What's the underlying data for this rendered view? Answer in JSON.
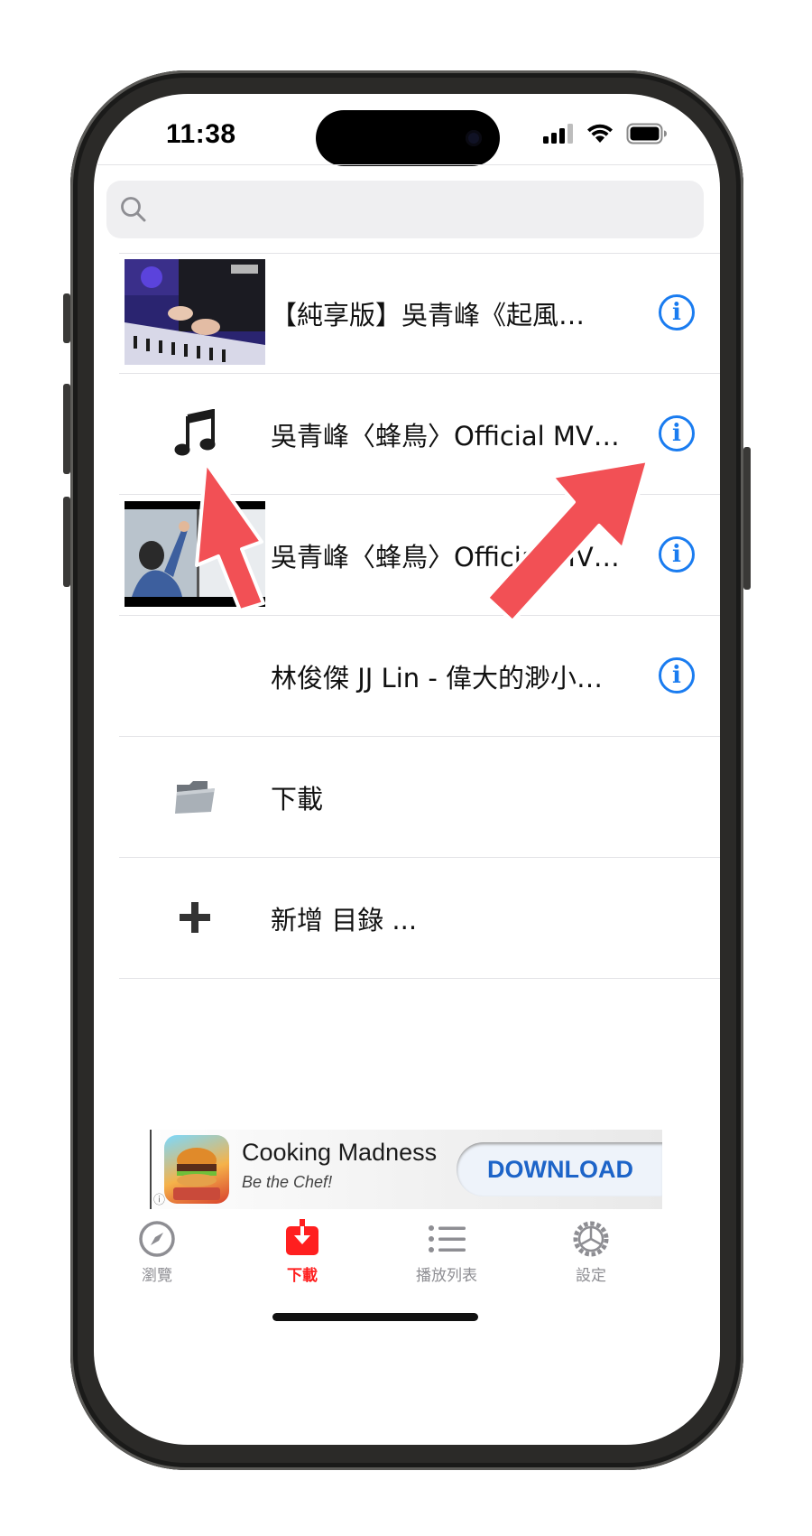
{
  "status": {
    "time": "11:38"
  },
  "search": {
    "placeholder": ""
  },
  "list": {
    "items": [
      {
        "title": "【純享版】吳青峰《起風…",
        "thumb": "concert-piano-thumbnail",
        "has_info": true
      },
      {
        "title": "吳青峰〈蜂鳥〉Official MV…",
        "thumb": "music-note-icon",
        "has_info": true
      },
      {
        "title": "吳青峰〈蜂鳥〉Official MV…",
        "thumb": "music-video-thumbnail",
        "has_info": true
      },
      {
        "title": "林俊傑 JJ Lin - 偉大的渺小…",
        "thumb": "none",
        "has_info": true
      },
      {
        "title": "下載",
        "thumb": "folder-icon",
        "has_info": false
      },
      {
        "title": "新增 目錄 ...",
        "thumb": "plus-icon",
        "has_info": false
      }
    ]
  },
  "ad": {
    "title": "Cooking Madness",
    "subtitle": "Be the Chef!",
    "cta": "DOWNLOAD"
  },
  "tabs": [
    {
      "label": "瀏覽",
      "icon": "compass-icon",
      "active": false
    },
    {
      "label": "下載",
      "icon": "download-icon",
      "active": true
    },
    {
      "label": "播放列表",
      "icon": "list-icon",
      "active": false
    },
    {
      "label": "設定",
      "icon": "gear-icon",
      "active": false
    }
  ],
  "colors": {
    "accent": "#1a7cf0",
    "active_tab": "#ff1f1f",
    "arrow": "#f25055"
  }
}
